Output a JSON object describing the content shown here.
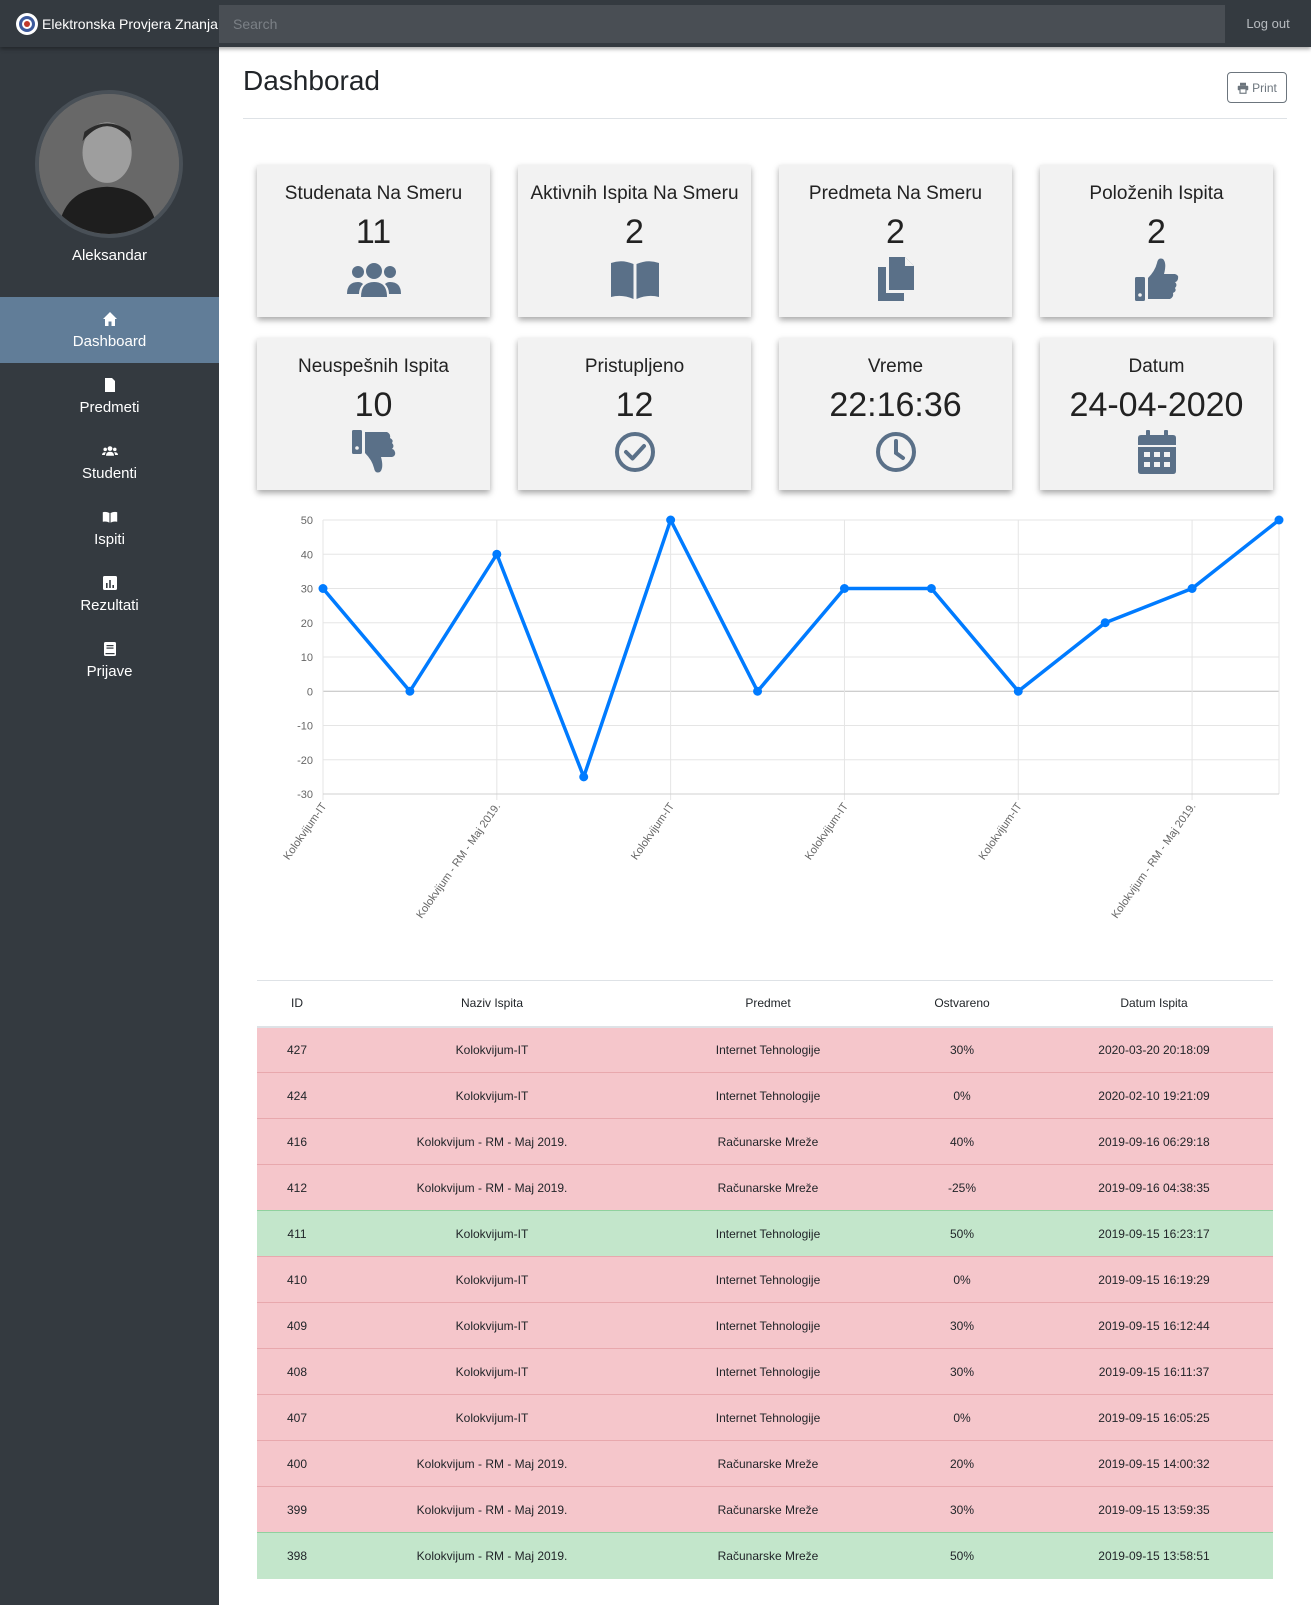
{
  "app": {
    "brand": "Elektronska Provjera Znanja",
    "logout": "Log out"
  },
  "search": {
    "placeholder": "Search",
    "value": ""
  },
  "user": {
    "name": "Aleksandar"
  },
  "sidebar": {
    "items": [
      {
        "label": "Dashboard",
        "icon": "home-icon",
        "active": true
      },
      {
        "label": "Predmeti",
        "icon": "file-icon",
        "active": false
      },
      {
        "label": "Studenti",
        "icon": "users-icon",
        "active": false
      },
      {
        "label": "Ispiti",
        "icon": "book-icon",
        "active": false
      },
      {
        "label": "Rezultati",
        "icon": "bar-chart-icon",
        "active": false
      },
      {
        "label": "Prijave",
        "icon": "notebook-icon",
        "active": false
      }
    ]
  },
  "page": {
    "title": "Dashborad",
    "print_label": "Print"
  },
  "cards": [
    {
      "label": "Studenata Na Smeru",
      "value": "11",
      "icon": "users-icon"
    },
    {
      "label": "Aktivnih Ispita Na Smeru",
      "value": "2",
      "icon": "book-open-icon"
    },
    {
      "label": "Predmeta Na Smeru",
      "value": "2",
      "icon": "copy-icon"
    },
    {
      "label": "Položenih Ispita",
      "value": "2",
      "icon": "thumbs-up-icon"
    },
    {
      "label": "Neuspešnih Ispita",
      "value": "10",
      "icon": "thumbs-down-icon"
    },
    {
      "label": "Pristupljeno",
      "value": "12",
      "icon": "check-circle-icon"
    },
    {
      "label": "Vreme",
      "value": "22:16:36",
      "icon": "clock-icon"
    },
    {
      "label": "Datum",
      "value": "24-04-2020",
      "icon": "calendar-icon"
    }
  ],
  "colors": {
    "sidebar_bg": "#343a40",
    "active_nav": "#617d98",
    "line": "#007bff",
    "icon": "#5a7088",
    "fail_row": "#f5c6cb",
    "pass_row": "#c3e6cb"
  },
  "chart_data": {
    "type": "line",
    "x": [
      "Kolokvijum-IT",
      "Kolokvijum-IT",
      "Kolokvijum - RM - Maj 2019.",
      "Kolokvijum - RM - Maj 2019.",
      "Kolokvijum-IT",
      "Kolokvijum-IT",
      "Kolokvijum-IT",
      "Kolokvijum-IT",
      "Kolokvijum-IT",
      "Kolokvijum - RM - Maj 2019.",
      "Kolokvijum - RM - Maj 2019.",
      "Kolokvijum - RM - Maj 2019."
    ],
    "x_tick_labels": [
      "Kolokvijum-IT",
      "Kolokvijum - RM - Maj 2019.",
      "Kolokvijum-IT",
      "Kolokvijum-IT",
      "Kolokvijum-IT",
      "Kolokvijum - RM - Maj 2019."
    ],
    "series": [
      {
        "values": [
          30,
          0,
          40,
          -25,
          50,
          0,
          30,
          30,
          0,
          20,
          30,
          50
        ]
      }
    ],
    "ylim": [
      -30,
      50
    ],
    "yticks": [
      50,
      40,
      30,
      20,
      10,
      0,
      -10,
      -20,
      -30
    ],
    "grid": true,
    "legend": "none"
  },
  "table": {
    "headers": [
      "ID",
      "Naziv Ispita",
      "Predmet",
      "Ostvareno",
      "Datum Ispita"
    ],
    "rows": [
      {
        "id": "427",
        "naziv": "Kolokvijum-IT",
        "predmet": "Internet Tehnologije",
        "ostvareno": "30%",
        "datum": "2020-03-20 20:18:09",
        "status": "fail"
      },
      {
        "id": "424",
        "naziv": "Kolokvijum-IT",
        "predmet": "Internet Tehnologije",
        "ostvareno": "0%",
        "datum": "2020-02-10 19:21:09",
        "status": "fail"
      },
      {
        "id": "416",
        "naziv": "Kolokvijum - RM - Maj 2019.",
        "predmet": "Računarske Mreže",
        "ostvareno": "40%",
        "datum": "2019-09-16 06:29:18",
        "status": "fail"
      },
      {
        "id": "412",
        "naziv": "Kolokvijum - RM - Maj 2019.",
        "predmet": "Računarske Mreže",
        "ostvareno": "-25%",
        "datum": "2019-09-16 04:38:35",
        "status": "fail"
      },
      {
        "id": "411",
        "naziv": "Kolokvijum-IT",
        "predmet": "Internet Tehnologije",
        "ostvareno": "50%",
        "datum": "2019-09-15 16:23:17",
        "status": "pass"
      },
      {
        "id": "410",
        "naziv": "Kolokvijum-IT",
        "predmet": "Internet Tehnologije",
        "ostvareno": "0%",
        "datum": "2019-09-15 16:19:29",
        "status": "fail"
      },
      {
        "id": "409",
        "naziv": "Kolokvijum-IT",
        "predmet": "Internet Tehnologije",
        "ostvareno": "30%",
        "datum": "2019-09-15 16:12:44",
        "status": "fail"
      },
      {
        "id": "408",
        "naziv": "Kolokvijum-IT",
        "predmet": "Internet Tehnologije",
        "ostvareno": "30%",
        "datum": "2019-09-15 16:11:37",
        "status": "fail"
      },
      {
        "id": "407",
        "naziv": "Kolokvijum-IT",
        "predmet": "Internet Tehnologije",
        "ostvareno": "0%",
        "datum": "2019-09-15 16:05:25",
        "status": "fail"
      },
      {
        "id": "400",
        "naziv": "Kolokvijum - RM - Maj 2019.",
        "predmet": "Računarske Mreže",
        "ostvareno": "20%",
        "datum": "2019-09-15 14:00:32",
        "status": "fail"
      },
      {
        "id": "399",
        "naziv": "Kolokvijum - RM - Maj 2019.",
        "predmet": "Računarske Mreže",
        "ostvareno": "30%",
        "datum": "2019-09-15 13:59:35",
        "status": "fail"
      },
      {
        "id": "398",
        "naziv": "Kolokvijum - RM - Maj 2019.",
        "predmet": "Računarske Mreže",
        "ostvareno": "50%",
        "datum": "2019-09-15 13:58:51",
        "status": "pass"
      }
    ]
  }
}
